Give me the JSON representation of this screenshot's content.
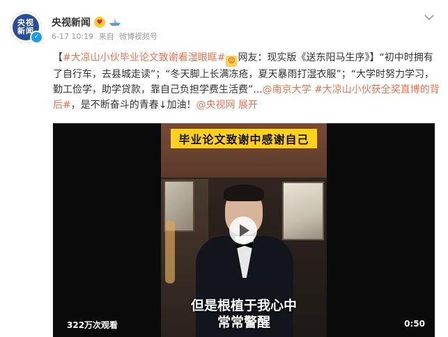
{
  "header": {
    "avatar_text": "央视新闻",
    "author_name": "央视新闻",
    "post_time": "6-17 10:19",
    "source_prefix": "来自",
    "source": "微博视频号"
  },
  "post": {
    "open_bracket": "【",
    "topic_main": "#大凉山小伙毕业论文致谢看湿眼眶#",
    "text_1": "网友：现实版《送东阳马生序》】“初中时拥有了自行车，去县城走读”；“冬天脚上长满冻疮，夏天暴雨打湿衣服”；“大学时努力学习，勤工俭学，助学贷款，靠自己负担学费生活费”...",
    "mention_1": "@南京大学",
    "topic_2": "#大凉山小伙获全奖直博的背后#",
    "text_2": "，是不断奋斗的青春↓加油！",
    "mention_2": "@央视网",
    "expand": "展开"
  },
  "video": {
    "caption_top": "毕业论文致谢中感谢自己",
    "subtitle_line1": "但是根植于我心中",
    "subtitle_line2": "常常警醒",
    "views": "322万次观看",
    "duration": "0:50"
  },
  "colors": {
    "link": "#eb7350",
    "avatar_bg": "#2a4d9b",
    "caption_bg": "#ffd11a"
  },
  "icons": [
    "chevron-down-icon",
    "verified-icon",
    "play-icon",
    "emoji-badge-icon",
    "ship-badge-icon"
  ]
}
